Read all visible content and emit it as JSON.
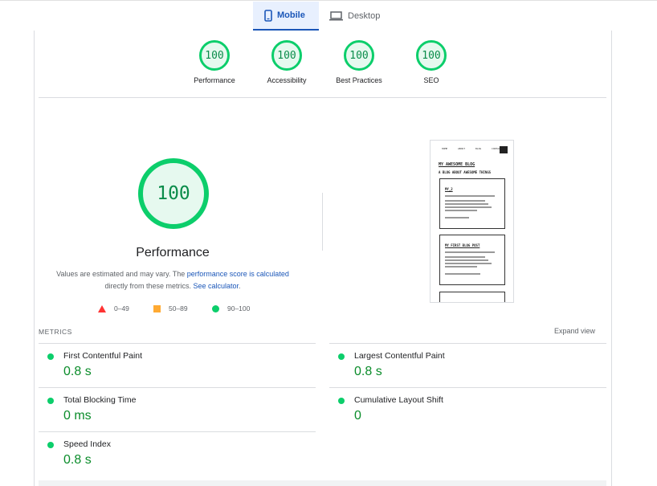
{
  "tabs": [
    {
      "label": "Mobile",
      "icon": "smartphone-icon",
      "active": true
    },
    {
      "label": "Desktop",
      "icon": "laptop-icon",
      "active": false
    }
  ],
  "category_gauges": [
    {
      "score": "100",
      "label": "Performance"
    },
    {
      "score": "100",
      "label": "Accessibility"
    },
    {
      "score": "100",
      "label": "Best Practices"
    },
    {
      "score": "100",
      "label": "SEO"
    }
  ],
  "performance": {
    "score": "100",
    "title": "Performance",
    "note_prefix": "Values are estimated and may vary. The ",
    "note_link1": "performance score is calculated",
    "note_mid": " directly from these metrics. ",
    "note_link2": "See calculator",
    "note_suffix": "."
  },
  "legend": {
    "fail": "0–49",
    "average": "50–89",
    "pass": "90–100"
  },
  "thumbnail": {
    "nav": [
      "HOME",
      "ABOUT",
      "BLOG",
      "CONTACT"
    ],
    "title": "MY AWESOME BLOG",
    "tagline": "A BLOG ABOUT AWESOME THINGS",
    "post1_title": "MY_2",
    "post2_title": "MY FIRST BLOG POST"
  },
  "metrics": {
    "title": "METRICS",
    "expand_label": "Expand view",
    "items": [
      {
        "name": "First Contentful Paint",
        "value": "0.8 s"
      },
      {
        "name": "Largest Contentful Paint",
        "value": "0.8 s"
      },
      {
        "name": "Total Blocking Time",
        "value": "0 ms"
      },
      {
        "name": "Cumulative Layout Shift",
        "value": "0"
      },
      {
        "name": "Speed Index",
        "value": "0.8 s"
      }
    ]
  },
  "colors": {
    "pass": "#0cce6b",
    "average": "#ffaa33",
    "fail": "#ff3333",
    "link": "#1a56b8",
    "metric_value": "#0a8c2a"
  }
}
